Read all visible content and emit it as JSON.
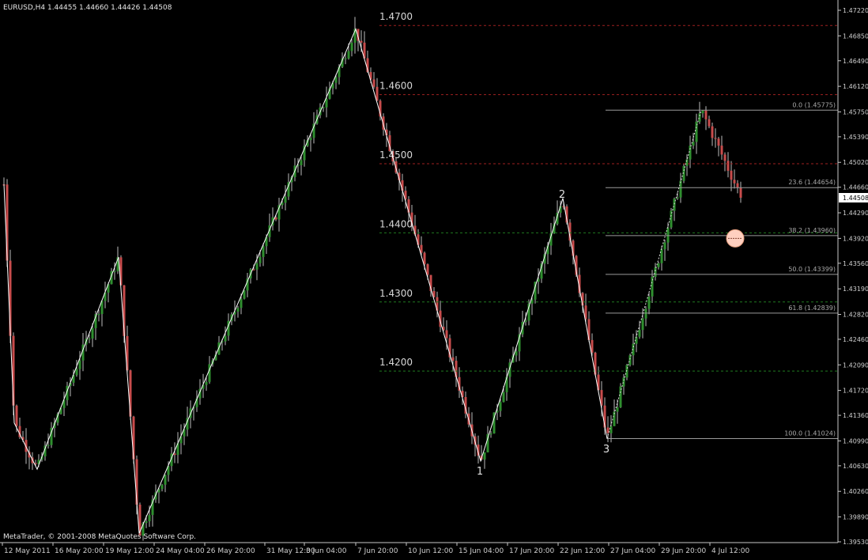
{
  "header": {
    "symbol": "EURUSD,H4",
    "ohlc": "1.44455 1.44660 1.44426 1.44508"
  },
  "footer": {
    "copyright": "MetaTrader, © 2001-2008 MetaQuotes Software Corp."
  },
  "colors": {
    "background": "#000000",
    "axis": "#c8c8c8",
    "bull": "#2f8f2f",
    "bear": "#c84c4c",
    "wick": "#bcbcbc",
    "zigzag": "#ffffff",
    "level_red": "#a02020",
    "level_green": "#1f7a1f",
    "fib": "#9a9a9a",
    "marker": "#ffd0c0"
  },
  "price_axis": {
    "ticks": [
      "1.47220",
      "1.46850",
      "1.46490",
      "1.46120",
      "1.45750",
      "1.45390",
      "1.45020",
      "1.44660",
      "1.44290",
      "1.43920",
      "1.43560",
      "1.43190",
      "1.42820",
      "1.42460",
      "1.42090",
      "1.41720",
      "1.41360",
      "1.40990",
      "1.40630",
      "1.40260",
      "1.39890",
      "1.39530"
    ],
    "current_price": "1.44508"
  },
  "time_axis": {
    "ticks": [
      "12 May 2011",
      "16 May 20:00",
      "19 May 12:00",
      "24 May 04:00",
      "26 May 20:00",
      "31 May 12:00",
      "3 Jun 04:00",
      "7 Jun 20:00",
      "10 Jun 12:00",
      "15 Jun 04:00",
      "17 Jun 20:00",
      "22 Jun 12:00",
      "27 Jun 04:00",
      "29 Jun 20:00",
      "4 Jul 12:00"
    ]
  },
  "levels": [
    {
      "label": "1.4700",
      "price": 1.47,
      "style": "red"
    },
    {
      "label": "1.4600",
      "price": 1.46,
      "style": "red"
    },
    {
      "label": "1.4500",
      "price": 1.45,
      "style": "red"
    },
    {
      "label": "1.4400",
      "price": 1.44,
      "style": "green"
    },
    {
      "label": "1.4300",
      "price": 1.43,
      "style": "green"
    },
    {
      "label": "1.4200",
      "price": 1.42,
      "style": "green"
    }
  ],
  "fibonacci": [
    {
      "label": "0.0 (1.45775)",
      "price": 1.45775
    },
    {
      "label": "23.6 (1.44654)",
      "price": 1.44654
    },
    {
      "label": "38.2 (1.43960)",
      "price": 1.4396
    },
    {
      "label": "50.0 (1.43399)",
      "price": 1.43399
    },
    {
      "label": "61.8 (1.42839)",
      "price": 1.42839
    },
    {
      "label": "100.0 (1.41024)",
      "price": 1.41024
    }
  ],
  "wave_labels": [
    "1",
    "2",
    "3"
  ],
  "chart_data": {
    "type": "candlestick",
    "symbol": "EURUSD",
    "timeframe": "H4",
    "ylim": [
      1.3953,
      1.4722
    ],
    "swings": [
      {
        "time": "12 May 2011",
        "price": 1.447
      },
      {
        "time": "13 May 2011",
        "price": 1.4125
      },
      {
        "time": "19 May 2011",
        "price": 1.4365
      },
      {
        "time": "23 May 2011",
        "price": 1.3965
      },
      {
        "time": "7 Jun 2011",
        "price": 1.4695
      },
      {
        "time": "15 Jun 2011",
        "price": 1.407,
        "label": "1"
      },
      {
        "time": "22 Jun 2011",
        "price": 1.445,
        "label": "2"
      },
      {
        "time": "27 Jun 2011",
        "price": 1.4102,
        "label": "3"
      },
      {
        "time": "1 Jul 2011",
        "price": 1.4578
      }
    ],
    "last_close": 1.44508
  }
}
